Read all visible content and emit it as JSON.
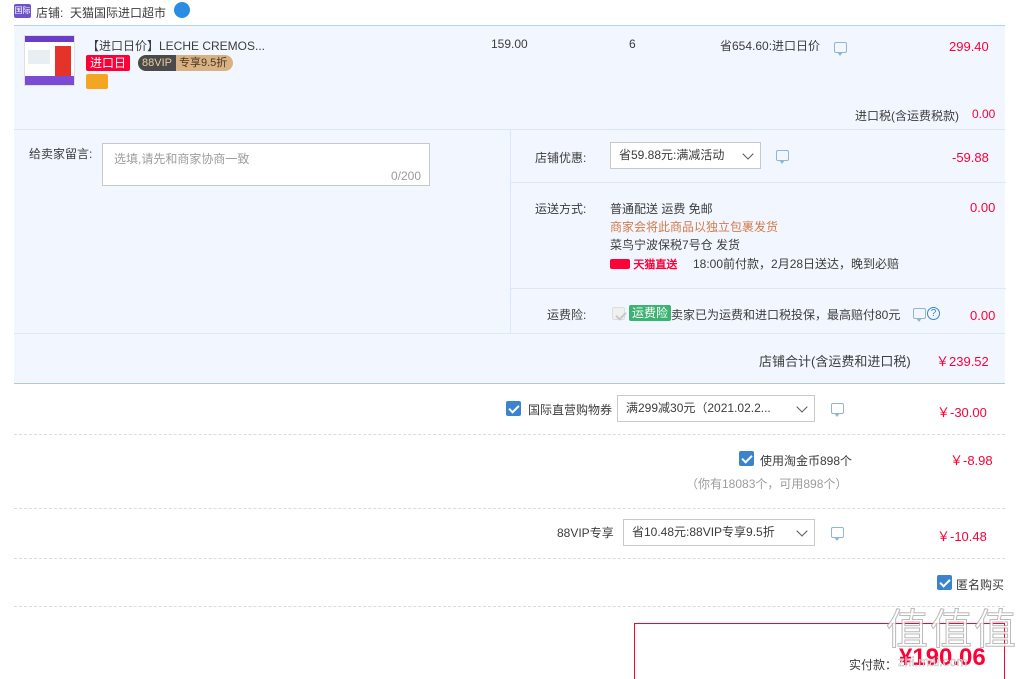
{
  "shop": {
    "label": "店铺:",
    "name": "天猫国际进口超市",
    "badge_text": "国际"
  },
  "item": {
    "title": "【进口日价】LECHE CREMOS...",
    "tag_import_day": "进口日",
    "tag_vip": "88VIP",
    "tag_vip_discount": "专享9.5折",
    "unit_price": "159.00",
    "quantity": "6",
    "save_text": "省654.60:进口日价",
    "subtotal": "299.40"
  },
  "tax": {
    "label": "进口税(含运费税款)",
    "value": "0.00"
  },
  "message": {
    "label": "给卖家留言:",
    "placeholder": "选填,请先和商家协商一致",
    "counter": "0/200"
  },
  "shop_discount": {
    "label": "店铺优惠:",
    "selected": "省59.88元:满减活动",
    "value": "-59.88"
  },
  "shipping": {
    "label": "运送方式:",
    "line1": "普通配送 运费 免邮",
    "line2": "商家会将此商品以独立包裹发货",
    "line3": "菜鸟宁波保税7号仓  发货",
    "logo_text": "天猫直送",
    "line4": "18:00前付款，2月28日送达，晚到必赔",
    "value": "0.00"
  },
  "insurance": {
    "label": "运费险:",
    "badge": "运费险",
    "text": "卖家已为运费和进口税投保，最高赔付80元",
    "value": "0.00"
  },
  "shop_total": {
    "label": "店铺合计(含运费和进口税)",
    "value": "￥239.52"
  },
  "coupon": {
    "label": "国际直营购物券",
    "selected": "满299减30元（2021.02.2...",
    "value": "￥-30.00"
  },
  "coins": {
    "label": "使用淘金币898个",
    "sub": "（你有18083个，可用898个）",
    "value": "￥-8.98"
  },
  "vip": {
    "label": "88VIP专享",
    "selected": "省10.48元:88VIP专享9.5折",
    "value": "￥-10.48"
  },
  "anonymous": {
    "label": "匿名购买"
  },
  "payment": {
    "label": "实付款：",
    "value": "¥190.06"
  },
  "watermark": {
    "text": "值值值",
    "url": "zhi.mai.com"
  },
  "colors": {
    "accent_red": "#ff0036",
    "checkbox_blue": "#3c83ce",
    "panel_blue": "#f2f7ff"
  }
}
